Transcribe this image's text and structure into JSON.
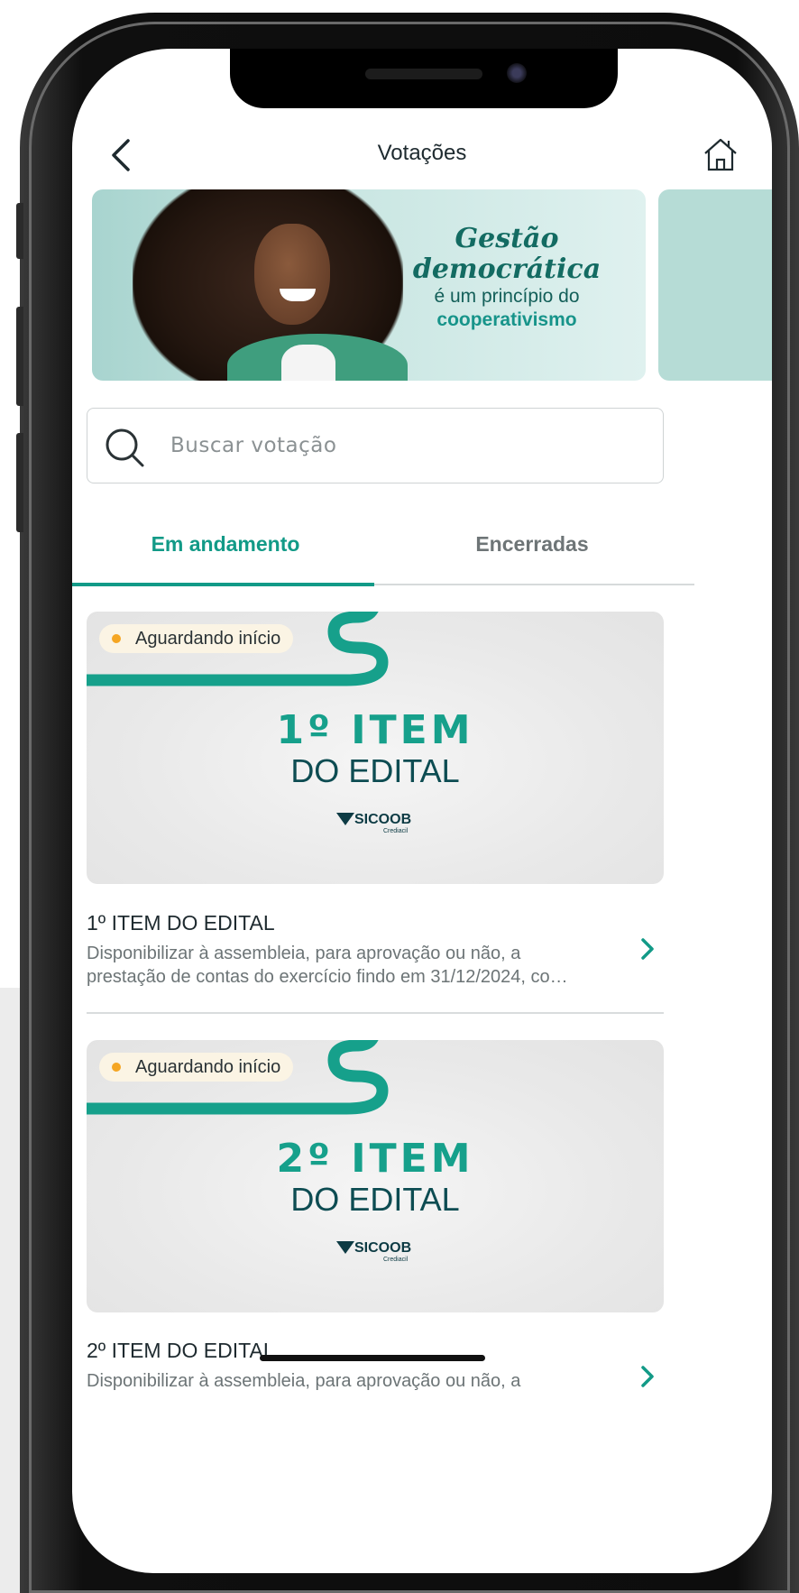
{
  "header": {
    "title": "Votações",
    "back_icon": "chevron-left-icon",
    "home_icon": "home-icon"
  },
  "banner": {
    "line1": "Gestão",
    "line2": "democrática",
    "line3": "é um princípio do",
    "line4": "cooperativismo"
  },
  "search": {
    "placeholder": "Buscar votação",
    "icon": "search-icon"
  },
  "tabs": [
    {
      "label": "Em andamento",
      "active": true
    },
    {
      "label": "Encerradas",
      "active": false
    }
  ],
  "cards": [
    {
      "badge": "Aguardando início",
      "image_number": "1º ITEM",
      "image_sub": "DO EDITAL",
      "logo": "SICOOB",
      "logo_sub": "Crediacil",
      "title": "1º ITEM DO EDITAL",
      "desc_line1": "Disponibilizar à assembleia, para aprovação ou não, a",
      "desc_line2": "prestação de contas do exercício findo em 31/12/2024, co…"
    },
    {
      "badge": "Aguardando início",
      "image_number": "2º ITEM",
      "image_sub": "DO EDITAL",
      "logo": "SICOOB",
      "logo_sub": "Crediacil",
      "title": "2º ITEM DO EDITAL",
      "desc_line1": "Disponibilizar à assembleia, para aprovação ou não, a",
      "desc_line2": ""
    }
  ],
  "colors": {
    "accent": "#129a87",
    "badge_dot": "#f5a623",
    "title_text": "#1e2a2f"
  }
}
